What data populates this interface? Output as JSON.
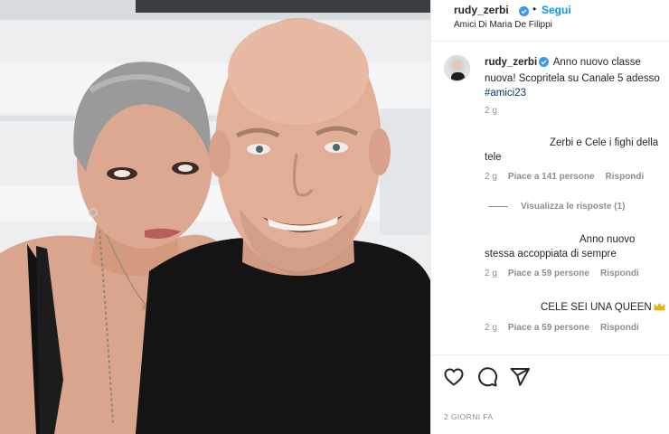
{
  "post": {
    "username": "rudy_zerbi",
    "follow_label": "Segui",
    "dot": "•",
    "location": "Amici Di Maria De Filippi",
    "accent_color": "#0095f6",
    "verified_color": "#3897f0"
  },
  "caption": {
    "username": "rudy_zerbi",
    "text": "Anno nuovo classe nuova! Scopritela su Canale 5 adesso",
    "hashtag": "#amici23",
    "time": "2 g"
  },
  "comments": [
    {
      "text": "Zerbi e Cele i fighi della tele",
      "time": "2 g",
      "likes": "Piace a 141 persone",
      "reply": "Rispondi"
    },
    {
      "text": "Anno nuovo stessa accoppiata di sempre",
      "time": "2 g",
      "likes": "Piace a 59 persone",
      "reply": "Rispondi"
    },
    {
      "text": "CELE SEI UNA QUEEN",
      "emoji": "crown-icon",
      "time": "2 g",
      "likes": "Piace a 59 persone",
      "reply": "Rispondi"
    }
  ],
  "view_replies": "Visualizza le risposte (1)",
  "actions": {
    "icons": [
      "heart-icon",
      "comment-icon",
      "share-icon"
    ]
  },
  "date": "2 GIORNI FA"
}
